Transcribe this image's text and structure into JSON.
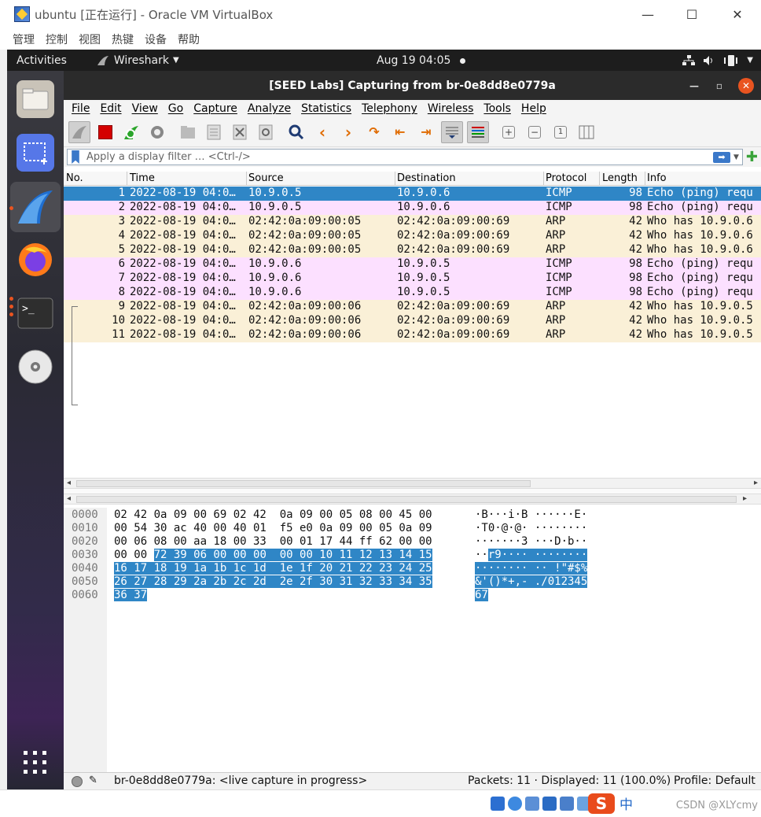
{
  "host": {
    "title": "ubuntu [正在运行] - Oracle VM VirtualBox",
    "controls": {
      "minimize": "—",
      "maximize": "☐",
      "close": "✕"
    },
    "menu": [
      "管理",
      "控制",
      "视图",
      "热键",
      "设备",
      "帮助"
    ]
  },
  "ubuntu": {
    "activities": "Activities",
    "app_name": "Wireshark",
    "clock": "Aug 19  04:05"
  },
  "wireshark": {
    "title": "[SEED Labs] Capturing from br-0e8dd8e0779a",
    "menu": [
      "File",
      "Edit",
      "View",
      "Go",
      "Capture",
      "Analyze",
      "Statistics",
      "Telephony",
      "Wireless",
      "Tools",
      "Help"
    ],
    "filter_placeholder": "Apply a display filter … <Ctrl-/>",
    "columns": [
      "No.",
      "Time",
      "Source",
      "Destination",
      "Protocol",
      "Length",
      "Info"
    ],
    "packets": [
      {
        "no": "1",
        "time": "2022-08-19 04:0…",
        "src": "10.9.0.5",
        "dst": "10.9.0.6",
        "proto": "ICMP",
        "len": "98",
        "info": "Echo (ping) requ",
        "type": "sel"
      },
      {
        "no": "2",
        "time": "2022-08-19 04:0…",
        "src": "10.9.0.5",
        "dst": "10.9.0.6",
        "proto": "ICMP",
        "len": "98",
        "info": "Echo (ping) requ",
        "type": "icmp"
      },
      {
        "no": "3",
        "time": "2022-08-19 04:0…",
        "src": "02:42:0a:09:00:05",
        "dst": "02:42:0a:09:00:69",
        "proto": "ARP",
        "len": "42",
        "info": "Who has 10.9.0.6",
        "type": "arp"
      },
      {
        "no": "4",
        "time": "2022-08-19 04:0…",
        "src": "02:42:0a:09:00:05",
        "dst": "02:42:0a:09:00:69",
        "proto": "ARP",
        "len": "42",
        "info": "Who has 10.9.0.6",
        "type": "arp"
      },
      {
        "no": "5",
        "time": "2022-08-19 04:0…",
        "src": "02:42:0a:09:00:05",
        "dst": "02:42:0a:09:00:69",
        "proto": "ARP",
        "len": "42",
        "info": "Who has 10.9.0.6",
        "type": "arp"
      },
      {
        "no": "6",
        "time": "2022-08-19 04:0…",
        "src": "10.9.0.6",
        "dst": "10.9.0.5",
        "proto": "ICMP",
        "len": "98",
        "info": "Echo (ping) requ",
        "type": "icmp"
      },
      {
        "no": "7",
        "time": "2022-08-19 04:0…",
        "src": "10.9.0.6",
        "dst": "10.9.0.5",
        "proto": "ICMP",
        "len": "98",
        "info": "Echo (ping) requ",
        "type": "icmp"
      },
      {
        "no": "8",
        "time": "2022-08-19 04:0…",
        "src": "10.9.0.6",
        "dst": "10.9.0.5",
        "proto": "ICMP",
        "len": "98",
        "info": "Echo (ping) requ",
        "type": "icmp"
      },
      {
        "no": "9",
        "time": "2022-08-19 04:0…",
        "src": "02:42:0a:09:00:06",
        "dst": "02:42:0a:09:00:69",
        "proto": "ARP",
        "len": "42",
        "info": "Who has 10.9.0.5",
        "type": "arp"
      },
      {
        "no": "10",
        "time": "2022-08-19 04:0…",
        "src": "02:42:0a:09:00:06",
        "dst": "02:42:0a:09:00:69",
        "proto": "ARP",
        "len": "42",
        "info": "Who has 10.9.0.5",
        "type": "arp"
      },
      {
        "no": "11",
        "time": "2022-08-19 04:0…",
        "src": "02:42:0a:09:00:06",
        "dst": "02:42:0a:09:00:69",
        "proto": "ARP",
        "len": "42",
        "info": "Who has 10.9.0.5",
        "type": "arp"
      }
    ],
    "bytes": [
      {
        "off": "0000",
        "hex_a": "02 42 0a 09 00 69 02 42  0a 09 00 05 08 00 45 00",
        "hex_b": "",
        "asc_a": "·B···i·B ······E·",
        "asc_b": ""
      },
      {
        "off": "0010",
        "hex_a": "00 54 30 ac 40 00 40 01  f5 e0 0a 09 00 05 0a 09",
        "hex_b": "",
        "asc_a": "·T0·@·@· ········",
        "asc_b": ""
      },
      {
        "off": "0020",
        "hex_a": "00 06 08 00 aa 18 00 33  00 01 17 44 ff 62 00 00",
        "hex_b": "",
        "asc_a": "·······3 ···D·b··",
        "asc_b": ""
      },
      {
        "off": "0030",
        "hex_a": "00 00 ",
        "hex_b": "72 39 06 00 00 00  00 00 10 11 12 13 14 15",
        "asc_a": "··",
        "asc_b": "r9···· ········"
      },
      {
        "off": "0040",
        "hex_a": "",
        "hex_b": "16 17 18 19 1a 1b 1c 1d  1e 1f 20 21 22 23 24 25",
        "asc_a": "",
        "asc_b": "········ ·· !\"#$%"
      },
      {
        "off": "0050",
        "hex_a": "",
        "hex_b": "26 27 28 29 2a 2b 2c 2d  2e 2f 30 31 32 33 34 35",
        "asc_a": "",
        "asc_b": "&'()*+,- ./012345"
      },
      {
        "off": "0060",
        "hex_a": "",
        "hex_b": "36 37",
        "asc_a": "",
        "asc_b": "67"
      }
    ],
    "status": {
      "iface": "br-0e8dd8e0779a: <live capture in progress>",
      "packets": "Packets: 11 · Displayed: 11 (100.0%)",
      "profile": "Profile: Default"
    }
  },
  "watermark": "CSDN @XLYcmy",
  "tray_char": "中"
}
